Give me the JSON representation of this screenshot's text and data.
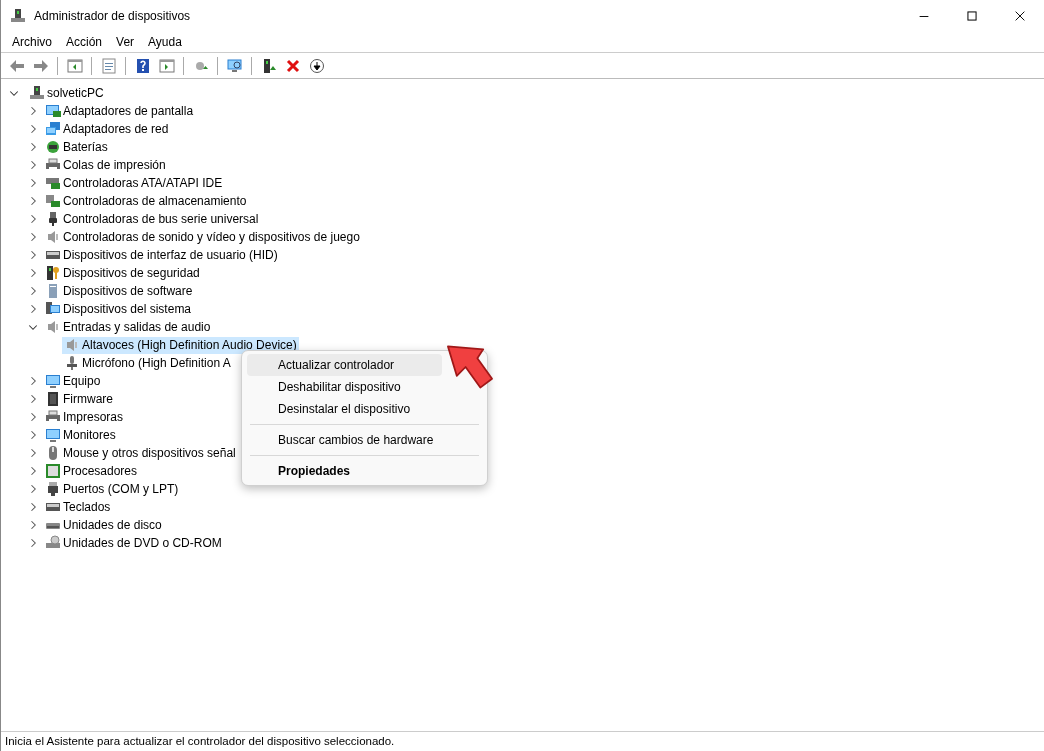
{
  "window": {
    "title": "Administrador de dispositivos"
  },
  "menu_bar": [
    "Archivo",
    "Acción",
    "Ver",
    "Ayuda"
  ],
  "tree": {
    "label": "solveticPC",
    "expanded": true,
    "children": [
      {
        "label": "Adaptadores de pantalla",
        "expanded": false
      },
      {
        "label": "Adaptadores de red",
        "expanded": false
      },
      {
        "label": "Baterías",
        "expanded": false
      },
      {
        "label": "Colas de impresión",
        "expanded": false
      },
      {
        "label": "Controladoras ATA/ATAPI IDE",
        "expanded": false
      },
      {
        "label": "Controladoras de almacenamiento",
        "expanded": false
      },
      {
        "label": "Controladoras de bus serie universal",
        "expanded": false
      },
      {
        "label": "Controladoras de sonido y vídeo y dispositivos de juego",
        "expanded": false
      },
      {
        "label": "Dispositivos de interfaz de usuario (HID)",
        "expanded": false
      },
      {
        "label": "Dispositivos de seguridad",
        "expanded": false
      },
      {
        "label": "Dispositivos de software",
        "expanded": false
      },
      {
        "label": "Dispositivos del sistema",
        "expanded": false
      },
      {
        "label": "Entradas y salidas de audio",
        "expanded": true,
        "children": [
          {
            "label": "Altavoces (High Definition Audio Device)",
            "selected": true
          },
          {
            "label": "Micrófono (High Definition A",
            "selected": false
          }
        ]
      },
      {
        "label": "Equipo",
        "expanded": false
      },
      {
        "label": "Firmware",
        "expanded": false
      },
      {
        "label": "Impresoras",
        "expanded": false
      },
      {
        "label": "Monitores",
        "expanded": false
      },
      {
        "label": "Mouse y otros dispositivos señal",
        "expanded": false
      },
      {
        "label": "Procesadores",
        "expanded": false
      },
      {
        "label": "Puertos (COM y LPT)",
        "expanded": false
      },
      {
        "label": "Teclados",
        "expanded": false
      },
      {
        "label": "Unidades de disco",
        "expanded": false
      },
      {
        "label": "Unidades de DVD o CD-ROM",
        "expanded": false
      }
    ]
  },
  "context_menu": {
    "items": [
      {
        "kind": "item",
        "label": "Actualizar controlador",
        "selected": true,
        "default": false
      },
      {
        "kind": "item",
        "label": "Deshabilitar dispositivo",
        "selected": false,
        "default": false
      },
      {
        "kind": "item",
        "label": "Desinstalar el dispositivo",
        "selected": false,
        "default": false
      },
      {
        "kind": "separator"
      },
      {
        "kind": "item",
        "label": "Buscar cambios de hardware",
        "selected": false,
        "default": false
      },
      {
        "kind": "separator"
      },
      {
        "kind": "item",
        "label": "Propiedades",
        "selected": false,
        "default": true
      }
    ]
  },
  "status_bar": "Inicia el Asistente para actualizar el controlador del dispositivo seleccionado."
}
